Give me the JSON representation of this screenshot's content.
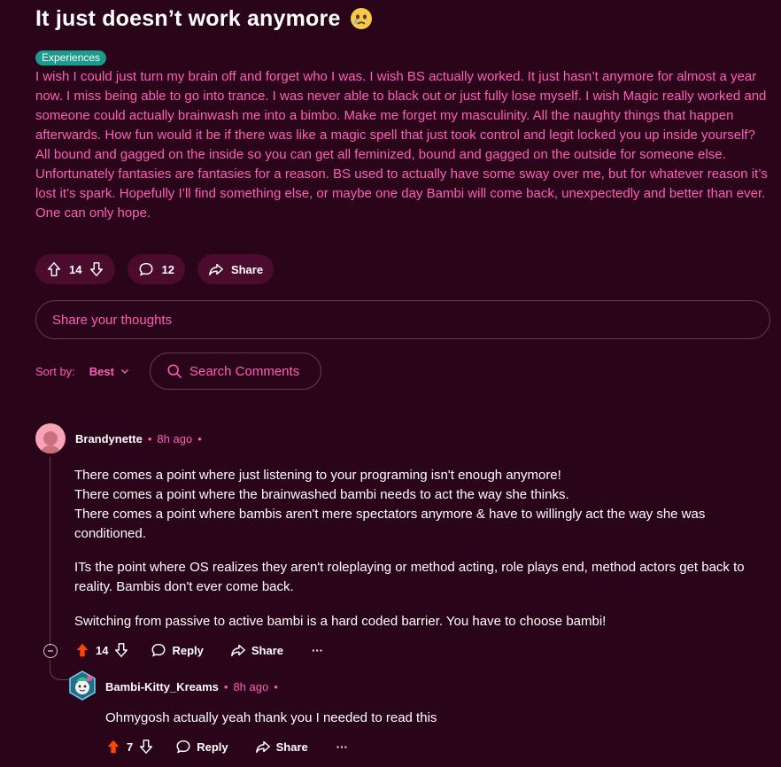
{
  "post": {
    "title": "It just doesn’t work anymore",
    "flair": "Experiences",
    "body": "I wish I could just turn my brain off and forget who I was. I wish BS actually worked. It just hasn’t anymore for almost a year now. I miss being able to go into trance. I was never able to black out or just fully lose myself. I wish Magic really worked and someone could actually brainwash me into a bimbo. Make me forget my masculinity. All the naughty things that happen afterwards. How fun would it be if there was like a magic spell that just took control and legit locked you up inside yourself? All bound and gagged on the inside so you can get all feminized, bound and gagged on the outside for someone else. Unfortunately fantasies are fantasies for a reason. BS used to actually have some sway over me, but for whatever reason it’s lost it’s spark. Hopefully I’ll find something else, or maybe one day Bambi will come back, unexpectedly and better than ever. One can only hope.",
    "votes": "14",
    "comments": "12",
    "share_label": "Share"
  },
  "composer": {
    "placeholder": "Share your thoughts"
  },
  "sort": {
    "label": "Sort by:",
    "value": "Best",
    "search_placeholder": "Search Comments"
  },
  "comments": [
    {
      "user": "Brandynette",
      "time": "8h ago",
      "paragraphs": [
        "There comes a point where just listening to your programing isn't enough anymore!\nThere comes a point where the brainwashed bambi needs to act the way she thinks.\nThere comes a point where bambis aren't mere spectators anymore & have to willingly act the way she was conditioned.",
        "ITs the point where OS realizes they aren't roleplaying or method acting, role plays end, method actors get back to reality. Bambis don't ever come back.",
        "Switching from passive to active bambi is a hard coded barrier. You have to choose bambi!"
      ],
      "votes": "14",
      "reply_label": "Reply",
      "share_label": "Share",
      "more": "···"
    },
    {
      "user": "Bambi-Kitty_Kreams",
      "time": "8h ago",
      "text": "Ohmygosh actually yeah thank you I needed to read this",
      "votes": "7",
      "reply_label": "Reply",
      "share_label": "Share",
      "more": "···"
    }
  ],
  "meta_sep": "•",
  "colors": {
    "background": "#2a0418",
    "accent": "#ff5fb8",
    "upvote_active": "#ff4500",
    "pill": "#4a0b2e",
    "flair": "#1c9a8c"
  }
}
